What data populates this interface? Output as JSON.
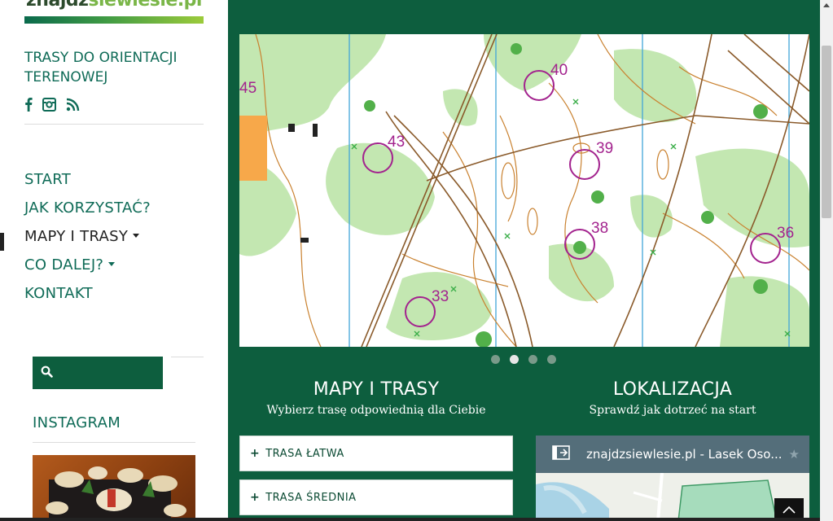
{
  "brand": {
    "logo_text_a": "znajdz",
    "logo_text_b": "siewlesie",
    "logo_text_c": ".pl",
    "tagline": "TRASY DO ORIENTACJI TERENOWEJ"
  },
  "social": [
    {
      "icon": "facebook-icon",
      "glyph": "f"
    },
    {
      "icon": "instagram-icon",
      "glyph": ""
    },
    {
      "icon": "rss-icon",
      "glyph": ""
    }
  ],
  "nav": [
    {
      "label": "START",
      "has_caret": false,
      "active": false
    },
    {
      "label": "JAK KORZYSTAĆ?",
      "has_caret": false,
      "active": false
    },
    {
      "label": "MAPY I TRASY",
      "has_caret": true,
      "active": true
    },
    {
      "label": "CO DALEJ?",
      "has_caret": true,
      "active": false
    },
    {
      "label": "KONTAKT",
      "has_caret": false,
      "active": false
    }
  ],
  "search": {
    "placeholder": "",
    "value": ""
  },
  "instagram": {
    "title": "INSTAGRAM"
  },
  "slider": {
    "dot_count": 4,
    "active_index": 1,
    "map_labels": [
      "45",
      "43",
      "40",
      "39",
      "38",
      "36",
      "33"
    ]
  },
  "maps_section": {
    "title": "MAPY I TRASY",
    "subtitle": "Wybierz trasę odpowiednią dla Ciebie",
    "routes": [
      {
        "label": "TRASA ŁATWA"
      },
      {
        "label": "TRASA ŚREDNIA"
      }
    ]
  },
  "location_section": {
    "title": "LOKALIZACJA",
    "subtitle": "Sprawdź jak dotrzeć na start",
    "map_title": "znajdzsiewlesie.pl - Lasek Oso..."
  },
  "colors": {
    "primary_green": "#0d5e3e",
    "text_green": "#0f6b57",
    "map_course": "#a3238e",
    "map_contour": "#c9812f",
    "map_vegetation": "#c3e7b1"
  }
}
